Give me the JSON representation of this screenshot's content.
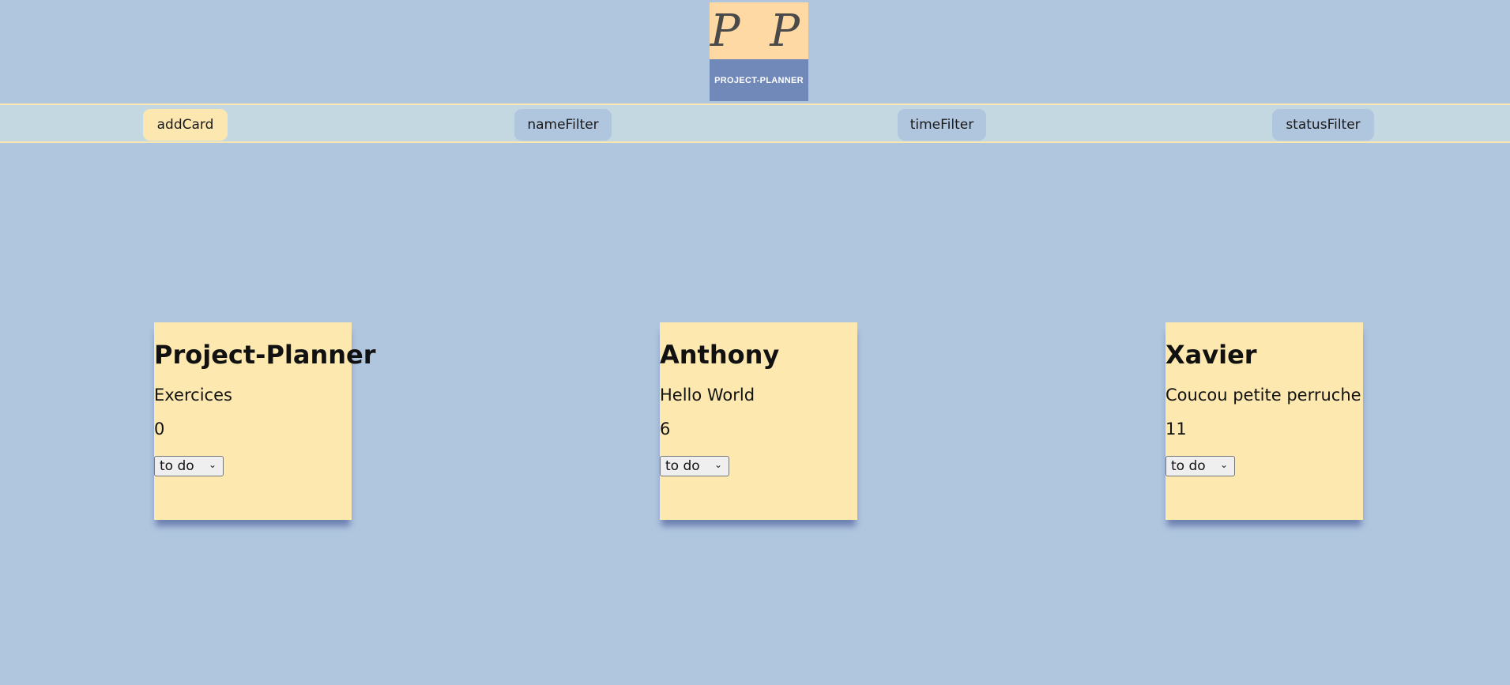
{
  "logo": {
    "letters": "P P",
    "name": "PROJECT-PLANNER"
  },
  "nav": {
    "add_card": "addCard",
    "name_filter": "nameFilter",
    "time_filter": "timeFilter",
    "status_filter": "statusFilter"
  },
  "cards": [
    {
      "title": "Project-Planner",
      "description": "Exercices",
      "time": "0",
      "status": "to do"
    },
    {
      "title": "Anthony",
      "description": "Hello World",
      "time": "6",
      "status": "to do"
    },
    {
      "title": "Xavier",
      "description": "Coucou petite perruche",
      "time": "11",
      "status": "to do"
    }
  ],
  "colors": {
    "background": "#b0c6df",
    "card": "#fde8b0",
    "logo_top": "#ffd9a3",
    "logo_bottom": "#7189b9",
    "nav_bar": "#c4d8e2"
  }
}
